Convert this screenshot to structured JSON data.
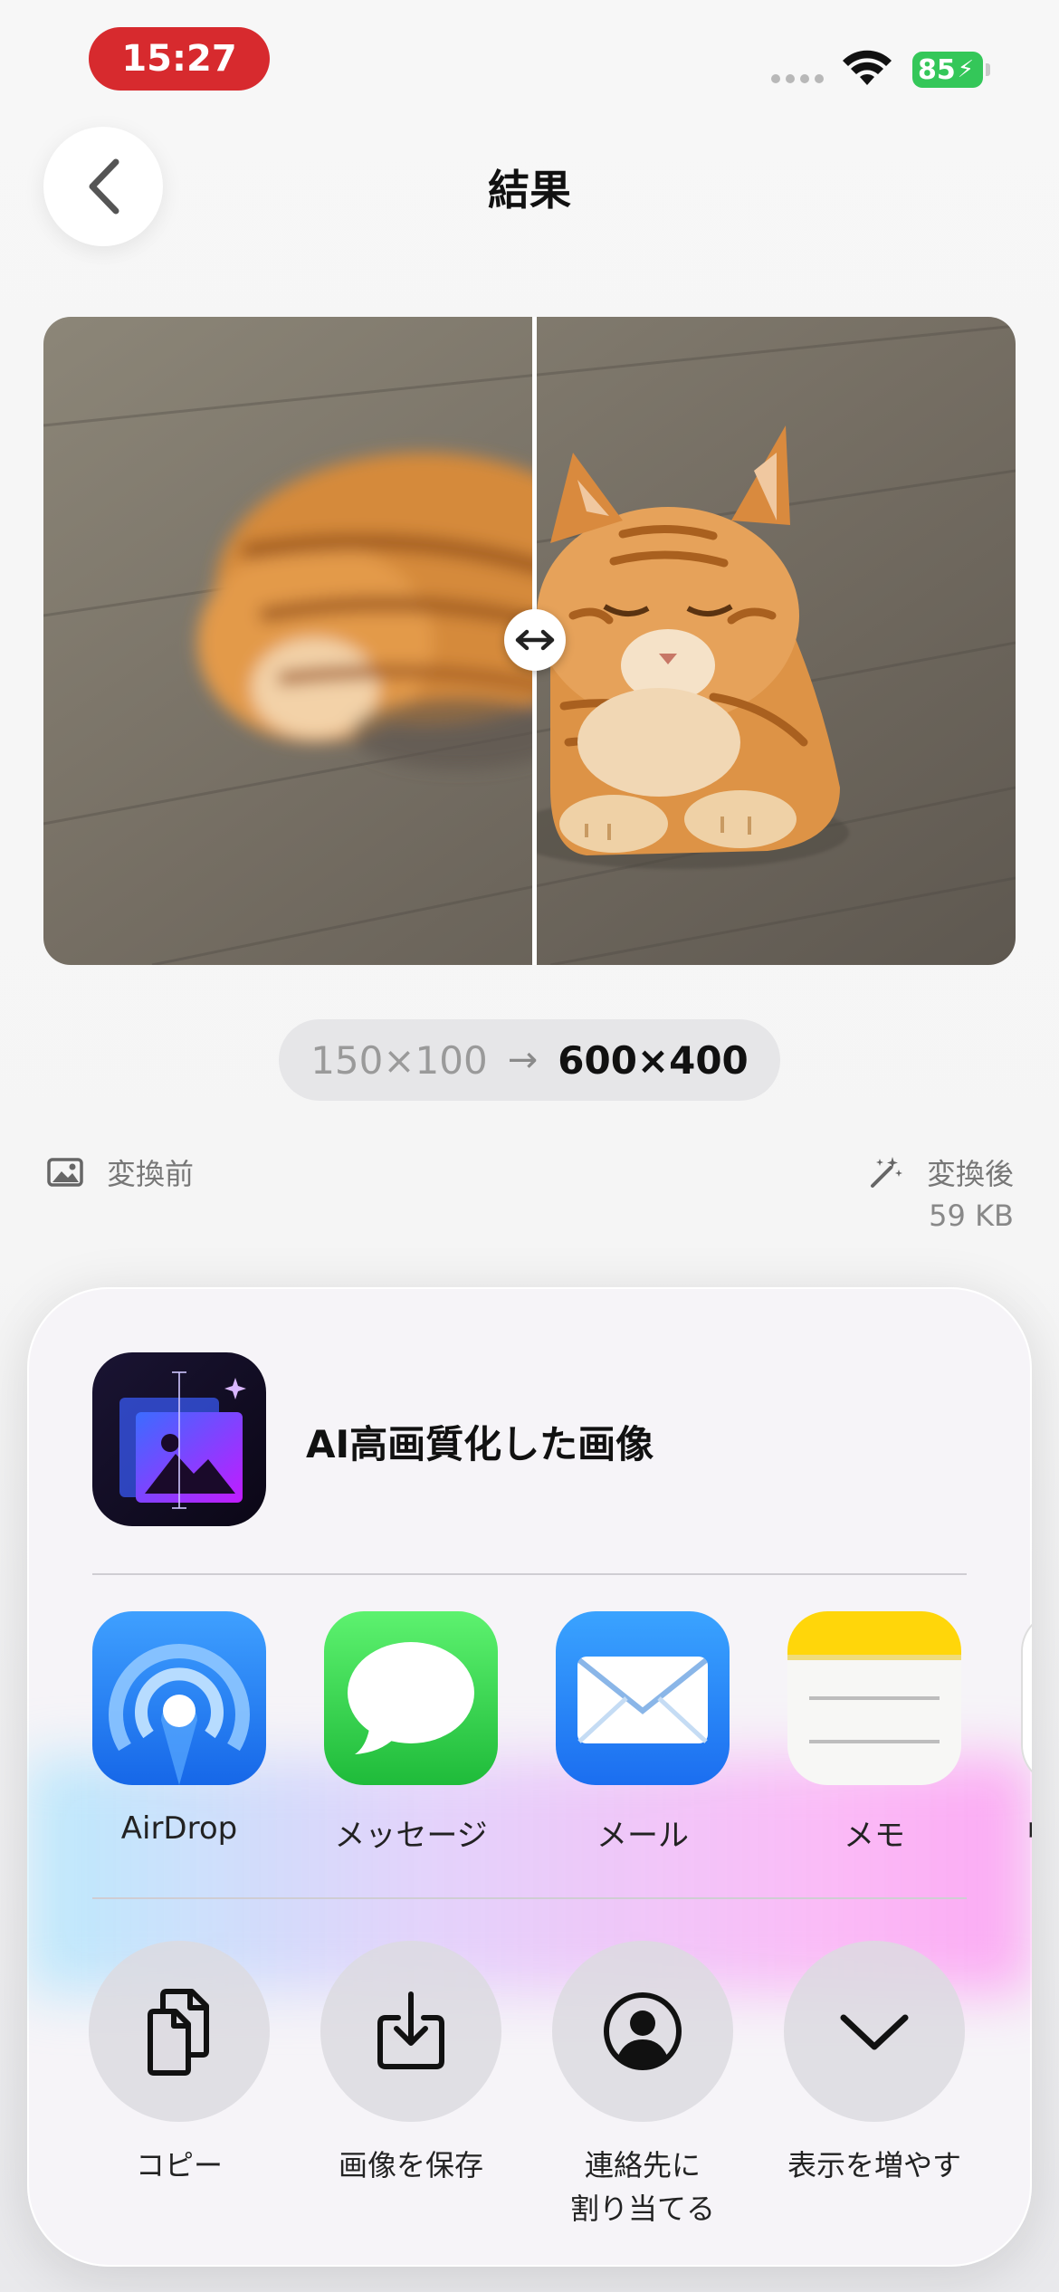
{
  "status_bar": {
    "time": "15:27",
    "battery": "85"
  },
  "nav": {
    "title": "結果"
  },
  "resolution": {
    "before": "150×100",
    "arrow": "→",
    "after": "600×400"
  },
  "labels": {
    "before": "変換前",
    "after": "変換後",
    "after_size": "59 KB"
  },
  "share_sheet": {
    "title": "AI高画質化した画像",
    "apps": [
      {
        "label": "AirDrop",
        "icon": "airdrop-icon"
      },
      {
        "label": "メッセージ",
        "icon": "messages-icon"
      },
      {
        "label": "メール",
        "icon": "mail-icon"
      },
      {
        "label": "メモ",
        "icon": "notes-icon"
      },
      {
        "label": "リ",
        "icon": "reminders-icon"
      }
    ],
    "actions": [
      {
        "label": "コピー",
        "icon": "copy-icon"
      },
      {
        "label": "画像を保存",
        "icon": "save-image-icon"
      },
      {
        "label_line1": "連絡先に",
        "label_line2": "割り当てる",
        "icon": "contact-icon"
      },
      {
        "label": "表示を増やす",
        "icon": "chevron-down-icon"
      }
    ]
  },
  "colors": {
    "time_pill": "#d72a2e",
    "battery": "#34c759",
    "mail": "#1f7cf5",
    "messages": "#34c759"
  }
}
